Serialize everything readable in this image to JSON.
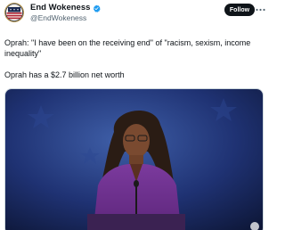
{
  "author": {
    "display_name": "End Wokeness",
    "handle": "@EndWokeness",
    "verified": true,
    "avatar_icon": "flag-seal-avatar"
  },
  "actions": {
    "follow_label": "Follow",
    "more_icon": "more-dots-icon"
  },
  "tweet": {
    "line1": "Oprah: \"I have been on the receiving end\" of \"racism, sexism, income inequality\"",
    "line2": "Oprah has a $2.7 billion net worth"
  },
  "media": {
    "kind": "photo",
    "subject": "speaker-at-podium"
  },
  "colors": {
    "text_primary": "#0f1419",
    "text_secondary": "#536471",
    "verified_blue": "#1d9bf0",
    "follow_bg": "#0f1419"
  }
}
